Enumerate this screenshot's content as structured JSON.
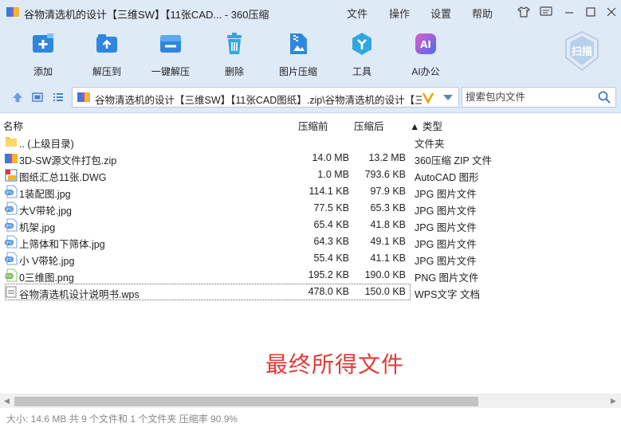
{
  "window": {
    "title": "谷物清选机的设计【三维SW】【11张CAD... - 360压缩",
    "menu": [
      "文件",
      "操作",
      "设置",
      "帮助"
    ]
  },
  "toolbar": {
    "items": [
      {
        "label": "添加",
        "icon": "add-icon",
        "color": "#2f86e0"
      },
      {
        "label": "解压到",
        "icon": "extract-to-icon",
        "color": "#2f86e0"
      },
      {
        "label": "一键解压",
        "icon": "one-click-extract-icon",
        "color": "#2f86e0"
      },
      {
        "label": "删除",
        "icon": "delete-icon",
        "color": "#2fa8e0"
      },
      {
        "label": "图片压缩",
        "icon": "image-compress-icon",
        "color": "#2f86e0"
      },
      {
        "label": "工具",
        "icon": "tools-icon",
        "color": "#2fa8e0"
      },
      {
        "label": "AI办公",
        "icon": "ai-office-icon",
        "color": "#7b5ce0"
      }
    ],
    "scan_label": "扫描"
  },
  "address": {
    "path": "谷物清选机的设计【三维SW】【11张CAD图纸】.zip\\谷物清选机的设计【三维",
    "search_placeholder": "搜索包内文件"
  },
  "columns": {
    "name": "名称",
    "compressed_before": "压缩前",
    "compressed_after": "压缩后",
    "type": "▲ 类型"
  },
  "files": [
    {
      "name": ".. (上级目录)",
      "before": "",
      "after": "",
      "type": "文件夹",
      "icon": "folder-icon"
    },
    {
      "name": "3D-SW源文件打包.zip",
      "before": "14.0 MB",
      "after": "13.2 MB",
      "type": "360压缩 ZIP 文件",
      "icon": "zip-icon"
    },
    {
      "name": "图纸汇总11张.DWG",
      "before": "1.0 MB",
      "after": "793.6 KB",
      "type": "AutoCAD 图形",
      "icon": "dwg-icon"
    },
    {
      "name": "1装配图.jpg",
      "before": "114.1 KB",
      "after": "97.9 KB",
      "type": "JPG 图片文件",
      "icon": "jpg-icon"
    },
    {
      "name": "大V带轮.jpg",
      "before": "77.5 KB",
      "after": "65.3 KB",
      "type": "JPG 图片文件",
      "icon": "jpg-icon"
    },
    {
      "name": "机架.jpg",
      "before": "65.4 KB",
      "after": "41.8 KB",
      "type": "JPG 图片文件",
      "icon": "jpg-icon"
    },
    {
      "name": "上筛体和下筛体.jpg",
      "before": "64.3 KB",
      "after": "49.1 KB",
      "type": "JPG 图片文件",
      "icon": "jpg-icon"
    },
    {
      "name": "小 V带轮.jpg",
      "before": "55.4 KB",
      "after": "41.1 KB",
      "type": "JPG 图片文件",
      "icon": "jpg-icon"
    },
    {
      "name": "0三维图.png",
      "before": "195.2 KB",
      "after": "190.0 KB",
      "type": "PNG 图片文件",
      "icon": "png-icon"
    },
    {
      "name": "谷物清选机设计说明书.wps",
      "before": "478.0 KB",
      "after": "150.0 KB",
      "type": "WPS文字 文档",
      "icon": "wps-icon"
    }
  ],
  "annotation": "最终所得文件",
  "status": "大小: 14.6 MB 共 9 个文件和 1 个文件夹 压缩率 90.9%"
}
